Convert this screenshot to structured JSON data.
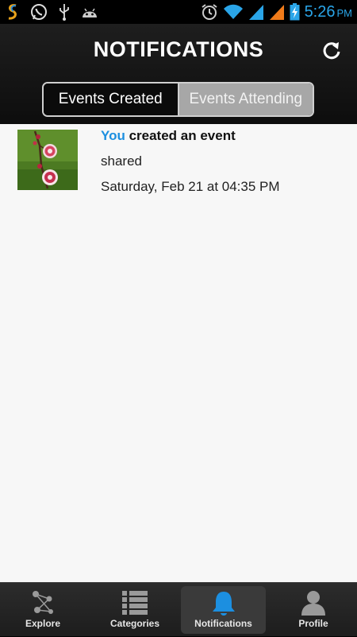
{
  "status": {
    "time": "5:26",
    "ampm": "PM"
  },
  "header": {
    "title": "NOTIFICATIONS"
  },
  "segments": {
    "created": "Events Created",
    "attending": "Events Attending"
  },
  "notification": {
    "you": "You",
    "action": " created an event",
    "name": "shared",
    "date": "Saturday, Feb 21 at 04:35 PM"
  },
  "tabs": {
    "explore": "Explore",
    "categories": "Categories",
    "notifications": "Notifications",
    "profile": "Profile"
  },
  "colors": {
    "accent": "#1c8fe0",
    "status_blue": "#2aa5e8"
  }
}
